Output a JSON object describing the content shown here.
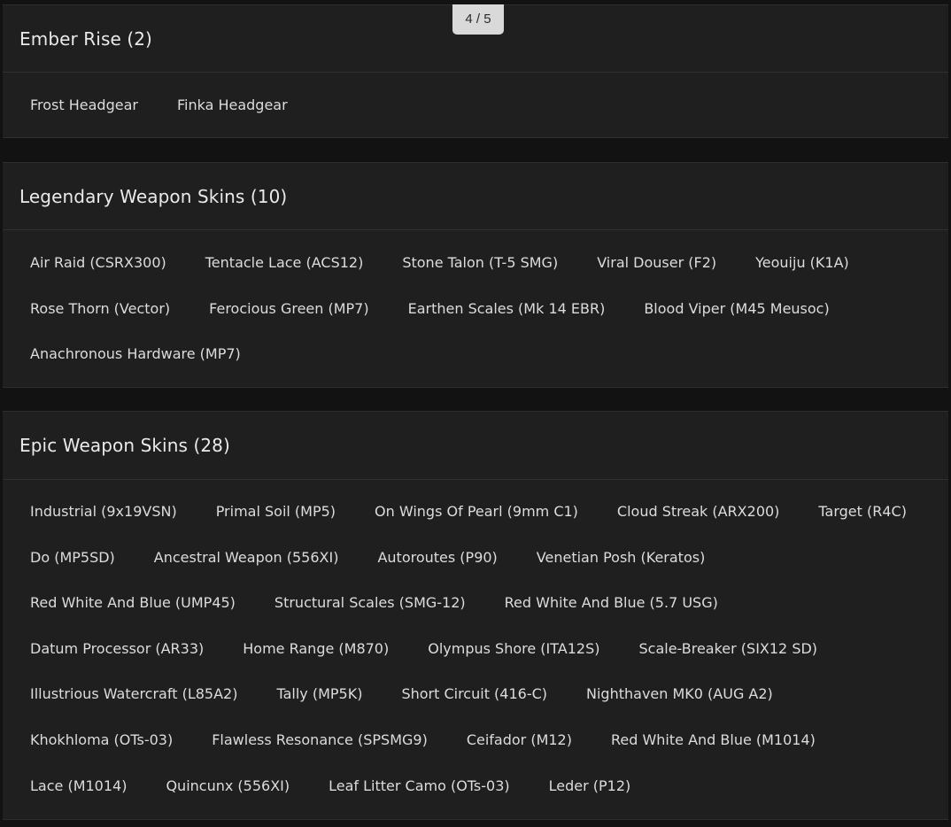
{
  "page_indicator": "4 / 5",
  "sections": [
    {
      "title": "Ember Rise (2)",
      "items": [
        "Frost Headgear",
        "Finka Headgear"
      ]
    },
    {
      "title": "Legendary Weapon Skins (10)",
      "items": [
        "Air Raid (CSRX300)",
        "Tentacle Lace (ACS12)",
        "Stone Talon (T-5 SMG)",
        "Viral Douser (F2)",
        "Yeouiju (K1A)",
        "Rose Thorn (Vector)",
        "Ferocious Green (MP7)",
        "Earthen Scales (Mk 14 EBR)",
        "Blood Viper (M45 Meusoc)",
        "Anachronous Hardware (MP7)"
      ]
    },
    {
      "title": "Epic Weapon Skins (28)",
      "items": [
        "Industrial (9x19VSN)",
        "Primal Soil (MP5)",
        "On Wings Of Pearl (9mm C1)",
        "Cloud Streak (ARX200)",
        "Target (R4C)",
        "Do (MP5SD)",
        "Ancestral Weapon (556XI)",
        "Autoroutes (P90)",
        "Venetian Posh (Keratos)",
        "Red White And Blue (UMP45)",
        "Structural Scales (SMG-12)",
        "Red White And Blue (5.7 USG)",
        "Datum Processor (AR33)",
        "Home Range (M870)",
        "Olympus Shore (ITA12S)",
        "Scale-Breaker (SIX12 SD)",
        "Illustrious Watercraft (L85A2)",
        "Tally (MP5K)",
        "Short Circuit (416-C)",
        "Nighthaven MK0 (AUG A2)",
        "Khokhloma (OTs-03)",
        "Flawless Resonance (SPSMG9)",
        "Ceifador (M12)",
        "Red White And Blue (M1014)",
        "Lace (M1014)",
        "Quincunx (556XI)",
        "Leaf Litter Camo (OTs-03)",
        "Leder (P12)"
      ]
    }
  ]
}
